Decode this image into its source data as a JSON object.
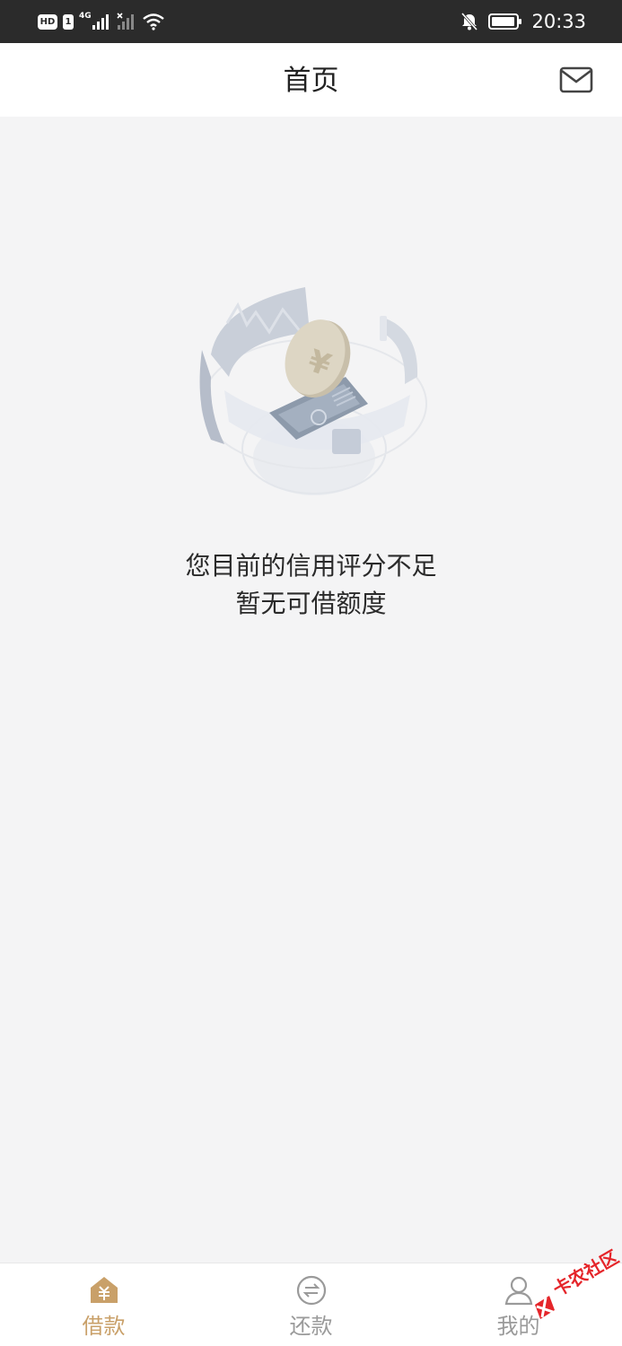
{
  "status_bar": {
    "hd": "HD",
    "sim": "1",
    "network": "4G",
    "time": "20:33"
  },
  "header": {
    "title": "首页",
    "mail_icon": "mail-icon"
  },
  "empty_state": {
    "illustration_icon": "yuan-coin-illustration",
    "line1": "您目前的信用评分不足",
    "line2": "暂无可借额度"
  },
  "tabs": [
    {
      "label": "借款",
      "icon": "home-yuan-icon",
      "active": true
    },
    {
      "label": "还款",
      "icon": "exchange-circle-icon",
      "active": false
    },
    {
      "label": "我的",
      "icon": "user-icon",
      "active": false
    }
  ],
  "watermark": {
    "text": "卡农社区"
  },
  "colors": {
    "accent": "#c9a069",
    "inactive": "#9a9a9a",
    "background": "#f4f4f5",
    "status_bar": "#2b2b2b"
  }
}
